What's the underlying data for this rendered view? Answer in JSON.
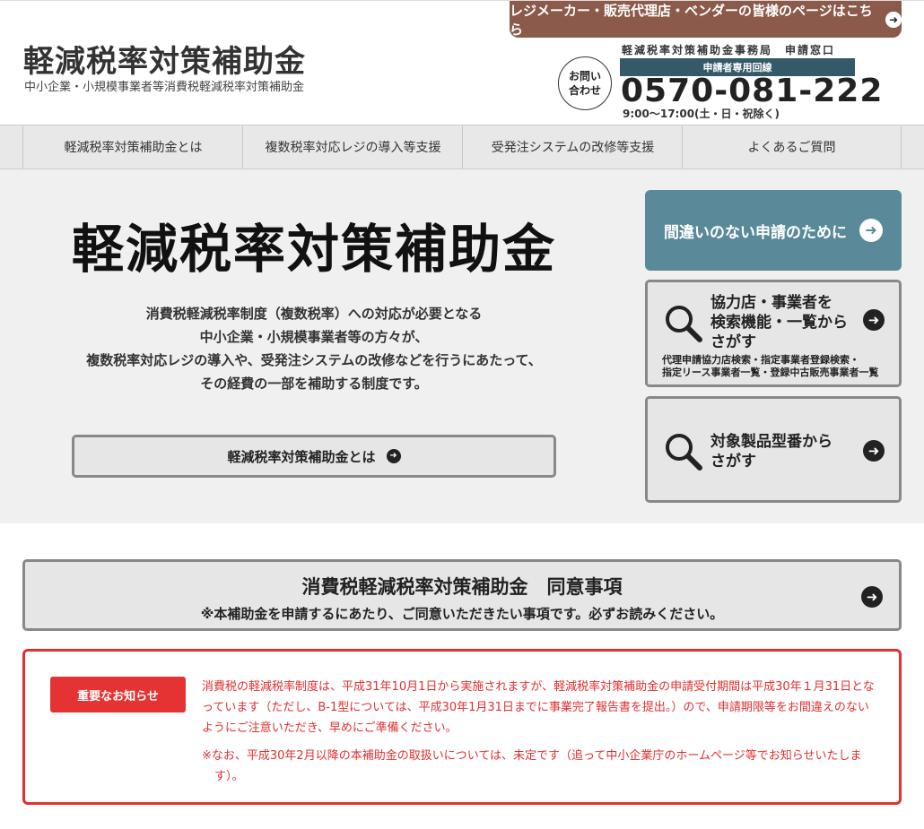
{
  "header": {
    "vendor_link": "レジメーカー・販売代理店・ベンダーの皆様のページはこちら",
    "site_title": "軽減税率対策補助金",
    "site_subtitle": "中小企業・小規模事業者等消費税軽減税率対策補助金",
    "inquiry_line1": "お問い",
    "inquiry_line2": "合わせ",
    "office_line": "軽減税率対策補助金事務局　申請窓口",
    "dedicated_line": "申請者専用回線",
    "phone": "0570-081-222",
    "hours": "9:00～17:00(土・日・祝除く)"
  },
  "nav": {
    "items": [
      "軽減税率対策補助金とは",
      "複数税率対応レジの導入等支援",
      "受発注システムの改修等支援",
      "よくあるご質問"
    ]
  },
  "hero": {
    "title": "軽減税率対策補助金",
    "lines": [
      "消費税軽減税率制度（複数税率）への対応が必要となる",
      "中小企業・小規模事業者等の方々が、",
      "複数税率対応レジの導入や、受発注システムの改修などを行うにあたって、",
      "その経費の一部を補助する制度です。"
    ],
    "about_button": "軽減税率対策補助金とは"
  },
  "side": {
    "apply_button": "間違いのない申請のために",
    "search1_line1": "協力店・事業者を",
    "search1_line2": "検索機能・一覧から",
    "search1_line3": "さがす",
    "search1_small1": "代理申請協力店検索・指定事業者登録検索・",
    "search1_small2": "指定リース事業者一覧・登録中古販売事業者一覧",
    "search2_line1": "対象製品型番から",
    "search2_line2": "さがす"
  },
  "agreement": {
    "title": "消費税軽減税率対策補助金　同意事項",
    "subtitle": "※本補助金を申請するにあたり、ご同意いただきたい事項です。必ずお読みください。"
  },
  "notice": {
    "badge": "重要なお知らせ",
    "text": "消費税の軽減税率制度は、平成31年10月1日から実施されますが、軽減税率対策補助金の申請受付期間は平成30年１月31日となっています（ただし、B-1型については、平成30年1月31日までに事業完了報告書を提出。）ので、申請期限等をお間違えのないようにご注意いただき、早めにご準備ください。",
    "note": "※なお、平成30年2月以降の本補助金の取扱いについては、未定です（追って中小企業庁のホームページ等でお知らせいたします）。"
  }
}
